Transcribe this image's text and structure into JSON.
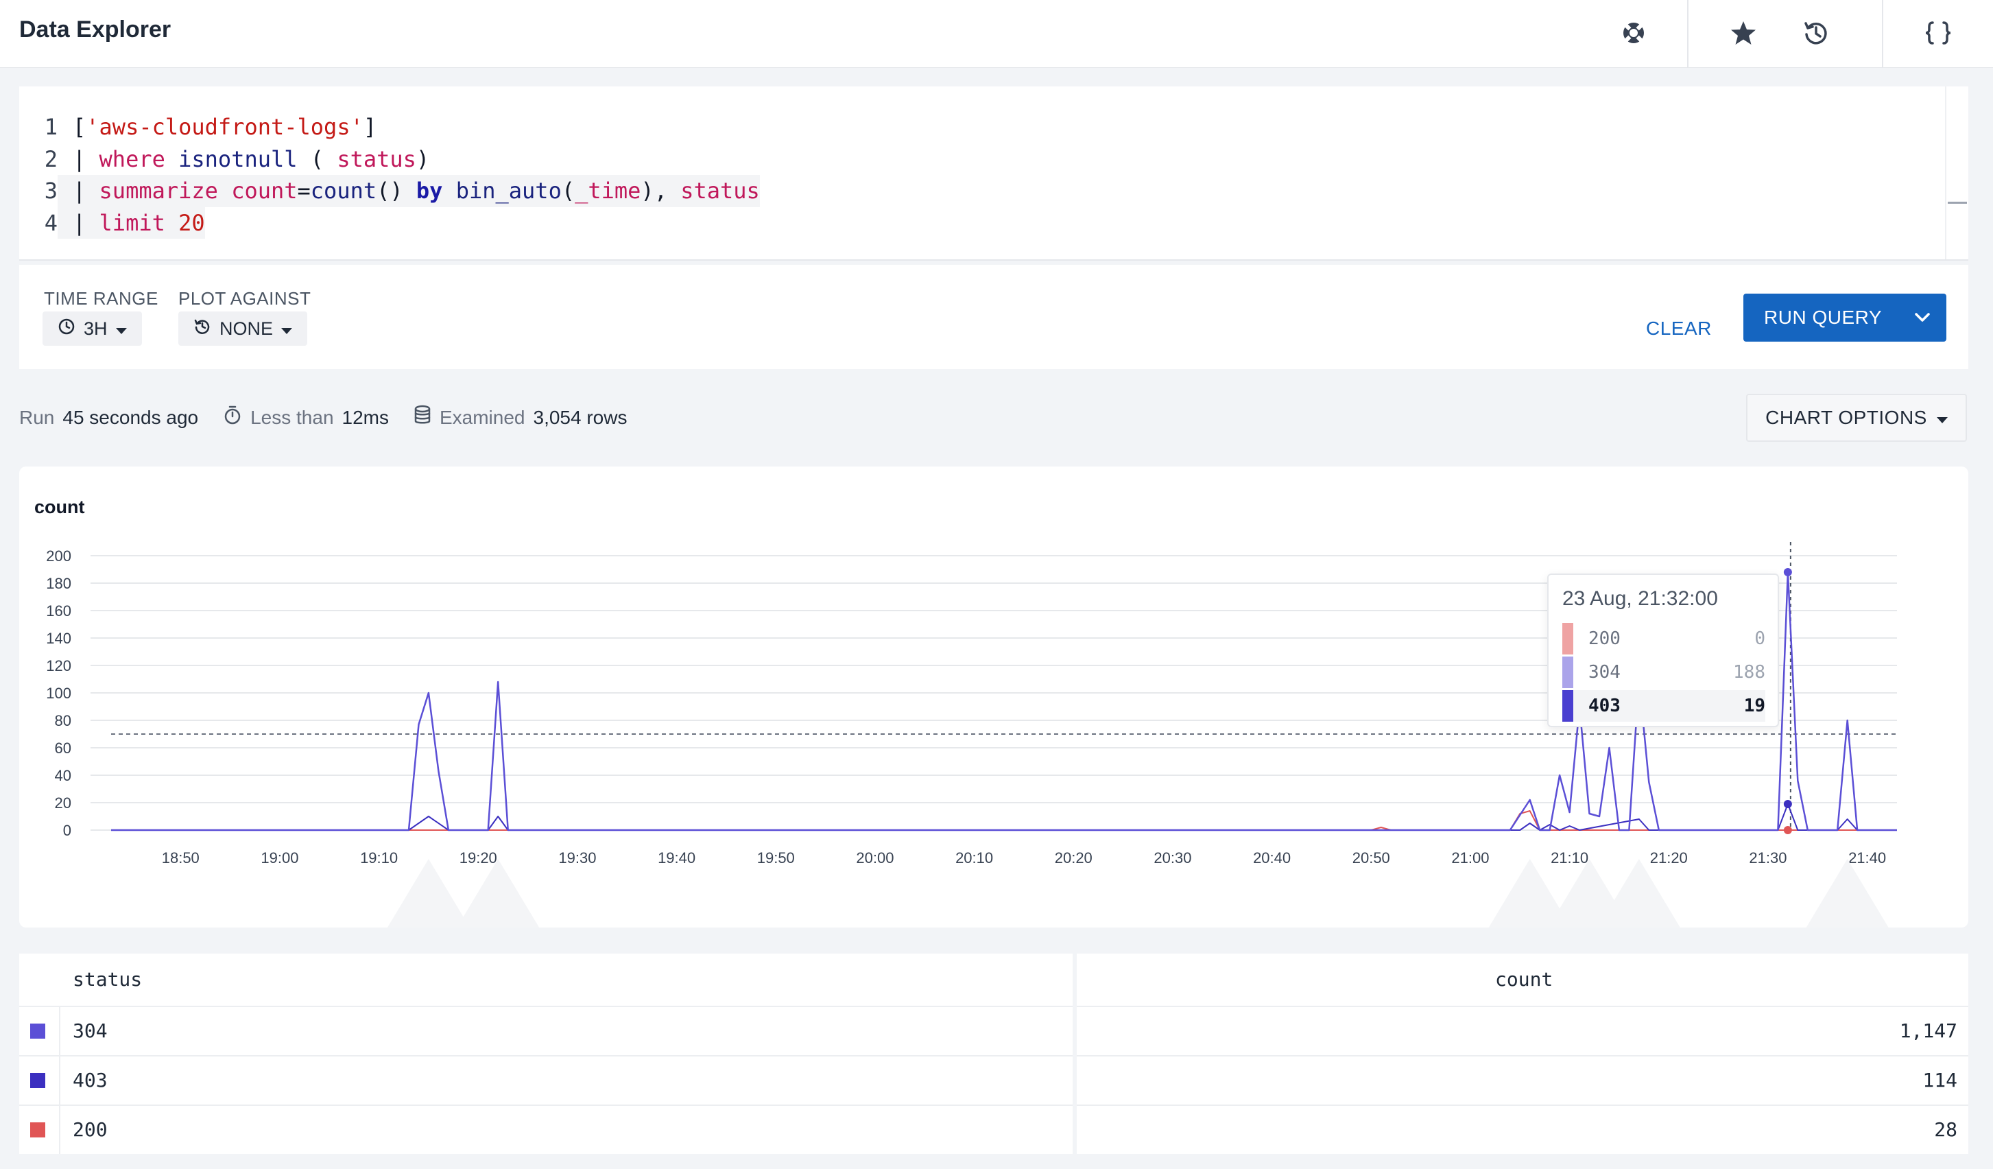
{
  "header": {
    "title": "Data Explorer",
    "icons": [
      "lifebuoy-icon",
      "star-icon",
      "history-icon",
      "braces-icon"
    ]
  },
  "editor": {
    "lines": [
      {
        "n": "1",
        "tokens": [
          {
            "t": "[",
            "c": "p"
          },
          {
            "t": "'aws-cloudfront-logs'",
            "c": "str"
          },
          {
            "t": "]",
            "c": "p"
          }
        ]
      },
      {
        "n": "2",
        "tokens": [
          {
            "t": "| ",
            "c": "p"
          },
          {
            "t": "where",
            "c": "kw"
          },
          {
            "t": " ",
            "c": "p"
          },
          {
            "t": "isnotnull",
            "c": "fn"
          },
          {
            "t": " ( ",
            "c": "p"
          },
          {
            "t": "status",
            "c": "kw"
          },
          {
            "t": ")",
            "c": "p"
          }
        ]
      },
      {
        "n": "3",
        "tokens": [
          {
            "t": "| ",
            "c": "p"
          },
          {
            "t": "summarize",
            "c": "kw"
          },
          {
            "t": " ",
            "c": "p"
          },
          {
            "t": "count",
            "c": "kw"
          },
          {
            "t": "=",
            "c": "p"
          },
          {
            "t": "count",
            "c": "fn"
          },
          {
            "t": "() ",
            "c": "p"
          },
          {
            "t": "by",
            "c": "by"
          },
          {
            "t": " ",
            "c": "p"
          },
          {
            "t": "bin_auto",
            "c": "fn"
          },
          {
            "t": "(",
            "c": "p"
          },
          {
            "t": "_time",
            "c": "kw"
          },
          {
            "t": "), ",
            "c": "p"
          },
          {
            "t": "status",
            "c": "kw"
          }
        ]
      },
      {
        "n": "4",
        "tokens": [
          {
            "t": "| ",
            "c": "p"
          },
          {
            "t": "limit",
            "c": "kw"
          },
          {
            "t": " ",
            "c": "p"
          },
          {
            "t": "20",
            "c": "str"
          }
        ]
      }
    ]
  },
  "controls": {
    "time_range_label": "TIME RANGE",
    "time_range_value": "3H",
    "plot_against_label": "PLOT AGAINST",
    "plot_against_value": "NONE",
    "clear_label": "CLEAR",
    "run_label": "RUN QUERY"
  },
  "meta": {
    "run_prefix": "Run",
    "run_value": "45 seconds ago",
    "duration_prefix": "Less than",
    "duration_value": "12ms",
    "examined_prefix": "Examined",
    "examined_value": "3,054 rows",
    "chart_options_label": "CHART OPTIONS"
  },
  "chart_data": {
    "type": "line",
    "ylabel": "count",
    "ylim": [
      0,
      200
    ],
    "yticks": [
      0,
      20,
      40,
      60,
      80,
      100,
      120,
      140,
      160,
      180,
      200
    ],
    "xticks": [
      "18:50",
      "19:00",
      "19:10",
      "19:20",
      "19:30",
      "19:40",
      "19:50",
      "20:00",
      "20:10",
      "20:20",
      "20:30",
      "20:40",
      "20:50",
      "21:00",
      "21:10",
      "21:20",
      "21:30",
      "21:40"
    ],
    "x_start": "18:43",
    "x_end": "21:43",
    "threshold": 70,
    "colors": {
      "200": "#e05555",
      "304": "#5b4fd6",
      "403": "#3b2fc0"
    },
    "series": [
      {
        "name": "304",
        "points": [
          [
            "18:43",
            0
          ],
          [
            "19:13",
            0
          ],
          [
            "19:14",
            77
          ],
          [
            "19:15",
            100
          ],
          [
            "19:16",
            43
          ],
          [
            "19:17",
            0
          ],
          [
            "19:21",
            0
          ],
          [
            "19:22",
            108
          ],
          [
            "19:23",
            0
          ],
          [
            "21:04",
            0
          ],
          [
            "21:06",
            22
          ],
          [
            "21:07",
            0
          ],
          [
            "21:08",
            0
          ],
          [
            "21:09",
            40
          ],
          [
            "21:10",
            13
          ],
          [
            "21:11",
            90
          ],
          [
            "21:12",
            12
          ],
          [
            "21:13",
            10
          ],
          [
            "21:14",
            60
          ],
          [
            "21:15",
            0
          ],
          [
            "21:16",
            0
          ],
          [
            "21:17",
            110
          ],
          [
            "21:18",
            35
          ],
          [
            "21:19",
            0
          ],
          [
            "21:31",
            0
          ],
          [
            "21:32",
            188
          ],
          [
            "21:33",
            36
          ],
          [
            "21:34",
            0
          ],
          [
            "21:37",
            0
          ],
          [
            "21:38",
            80
          ],
          [
            "21:39",
            0
          ],
          [
            "21:43",
            0
          ]
        ]
      },
      {
        "name": "403",
        "points": [
          [
            "18:43",
            0
          ],
          [
            "19:13",
            0
          ],
          [
            "19:15",
            10
          ],
          [
            "19:17",
            0
          ],
          [
            "19:21",
            0
          ],
          [
            "19:22",
            10
          ],
          [
            "19:23",
            0
          ],
          [
            "21:05",
            0
          ],
          [
            "21:06",
            5
          ],
          [
            "21:07",
            0
          ],
          [
            "21:08",
            4
          ],
          [
            "21:09",
            0
          ],
          [
            "21:10",
            3
          ],
          [
            "21:11",
            0
          ],
          [
            "21:17",
            8
          ],
          [
            "21:18",
            0
          ],
          [
            "21:31",
            0
          ],
          [
            "21:32",
            19
          ],
          [
            "21:33",
            0
          ],
          [
            "21:37",
            0
          ],
          [
            "21:38",
            8
          ],
          [
            "21:39",
            0
          ],
          [
            "21:43",
            0
          ]
        ]
      },
      {
        "name": "200",
        "points": [
          [
            "18:43",
            0
          ],
          [
            "20:50",
            0
          ],
          [
            "20:51",
            2
          ],
          [
            "20:52",
            0
          ],
          [
            "21:04",
            0
          ],
          [
            "21:05",
            12
          ],
          [
            "21:06",
            14
          ],
          [
            "21:07",
            0
          ],
          [
            "21:43",
            0
          ]
        ]
      }
    ],
    "hover": {
      "time": "21:32",
      "x_label": "23 Aug, 21:32:00",
      "values": [
        {
          "name": "200",
          "value": "0"
        },
        {
          "name": "304",
          "value": "188"
        },
        {
          "name": "403",
          "value": "19"
        }
      ],
      "highlight": "403"
    }
  },
  "table": {
    "headers": {
      "status": "status",
      "count": "count"
    },
    "rows": [
      {
        "status": "304",
        "count": "1,147",
        "color": "#5b4fd6"
      },
      {
        "status": "403",
        "count": "114",
        "color": "#3b2fc0"
      },
      {
        "status": "200",
        "count": "28",
        "color": "#e05555"
      }
    ]
  }
}
